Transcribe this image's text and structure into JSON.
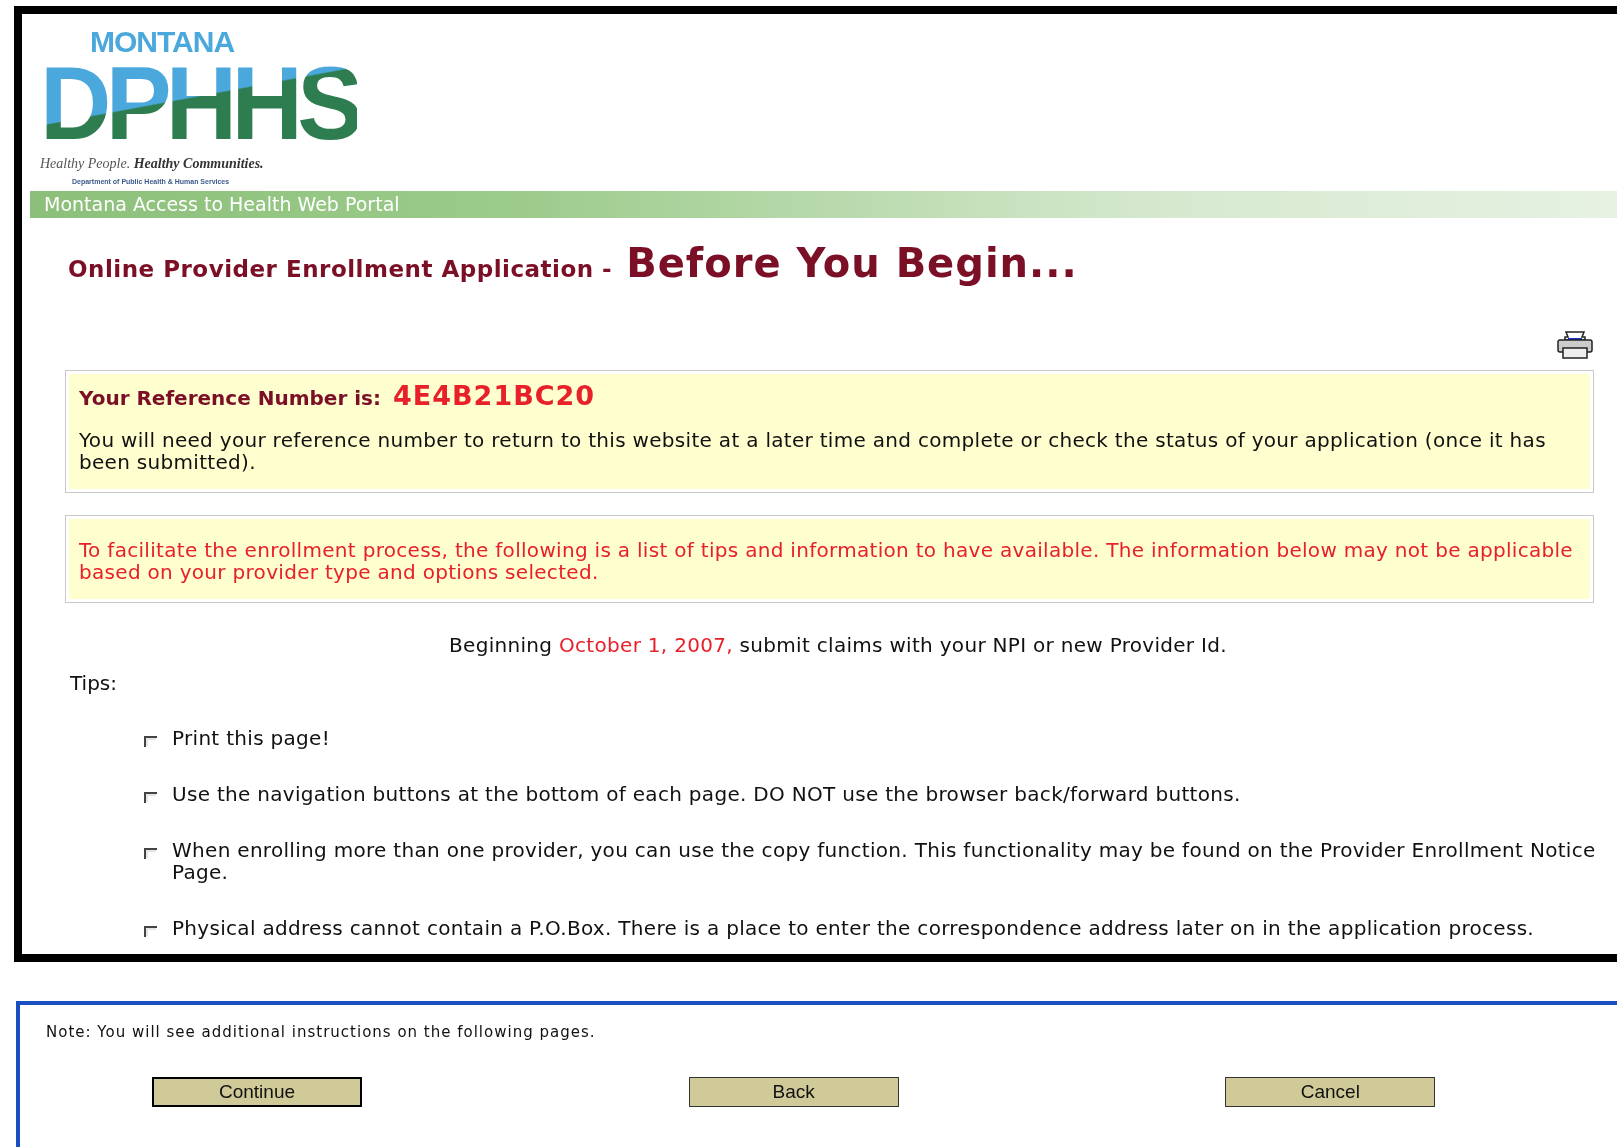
{
  "logo": {
    "state": "MONTANA",
    "acronym": "DPHHS",
    "tagline_plain": "Healthy People.",
    "tagline_bold": "Healthy Communities.",
    "department": "Department of Public Health & Human Services"
  },
  "portal_bar": "Montana Access to Health Web Portal",
  "heading": {
    "prefix": "Online Provider Enrollment Application -",
    "title": "Before You Begin..."
  },
  "reference": {
    "label": "Your Reference Number is:",
    "number": "4E4B21BC20",
    "text": "You will need your reference number to return to this website at a later time and complete or check the status of your application (once it has been submitted)."
  },
  "notice": "To facilitate the enrollment process, the following is a list of tips and information to have available. The information below may not be applicable based on your provider type and options selected.",
  "beginning": {
    "before": "Beginning",
    "date": "October 1, 2007,",
    "after": "submit claims with your NPI or new Provider Id."
  },
  "tips_label": "Tips:",
  "tips": [
    "Print this page!",
    "Use the navigation buttons at the bottom of each page. DO NOT use the browser back/forward buttons.",
    "When enrolling more than one provider, you can use the copy function. This functionality may be found on the Provider Enrollment Notice Page.",
    "Physical address cannot contain a P.O.Box. There is a place to enter the correspondence address later on in the application process."
  ],
  "note": "Note: You will see additional instructions on the following pages.",
  "buttons": [
    {
      "label": "Continue",
      "focused": true
    },
    {
      "label": "Back",
      "focused": false
    },
    {
      "label": "Cancel",
      "focused": false
    }
  ]
}
